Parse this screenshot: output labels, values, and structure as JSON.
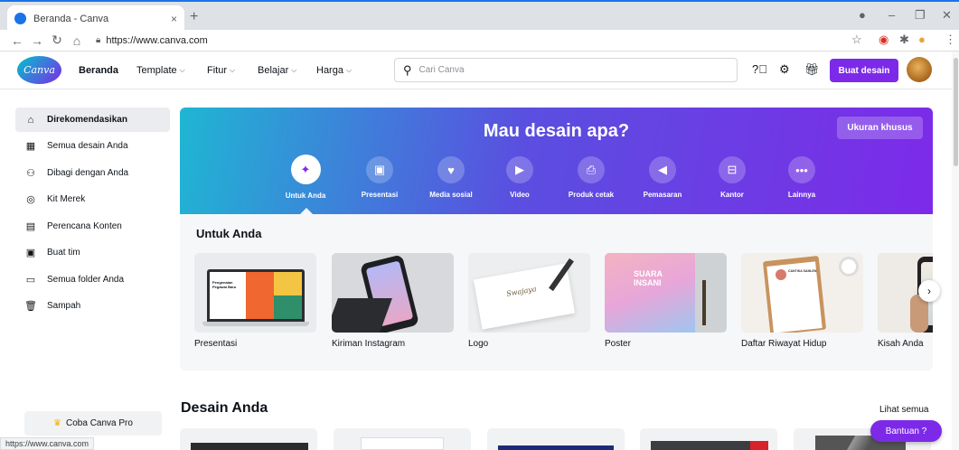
{
  "browser": {
    "tab_title": "Beranda - Canva",
    "tab_close": "×",
    "new_tab": "+",
    "url": "https://www.canva.com",
    "status_url": "https://www.canva.com"
  },
  "header": {
    "logo_text": "Canva",
    "nav": [
      {
        "label": "Beranda",
        "dropdown": false
      },
      {
        "label": "Template",
        "dropdown": true
      },
      {
        "label": "Fitur",
        "dropdown": true
      },
      {
        "label": "Belajar",
        "dropdown": true
      },
      {
        "label": "Harga",
        "dropdown": true
      }
    ],
    "search_placeholder": "Cari Canva",
    "create_button": "Buat desain"
  },
  "sidebar": {
    "items": [
      {
        "label": "Direkomendasikan",
        "icon": "home-icon",
        "active": true
      },
      {
        "label": "Semua desain Anda",
        "icon": "grid-icon",
        "active": false
      },
      {
        "label": "Dibagi dengan Anda",
        "icon": "shared-icon",
        "active": false
      },
      {
        "label": "Kit Merek",
        "icon": "brand-kit-icon",
        "active": false
      },
      {
        "label": "Perencana Konten",
        "icon": "calendar-icon",
        "active": false
      },
      {
        "label": "Buat tim",
        "icon": "team-icon",
        "active": false
      },
      {
        "label": "Semua folder Anda",
        "icon": "folder-icon",
        "active": false
      },
      {
        "label": "Sampah",
        "icon": "trash-icon",
        "active": false
      }
    ],
    "pro_button": "Coba Canva Pro"
  },
  "hero": {
    "title": "Mau desain apa?",
    "custom_size_button": "Ukuran khusus",
    "categories": [
      {
        "label": "Untuk Anda",
        "icon": "sparkle-icon",
        "active": true
      },
      {
        "label": "Presentasi",
        "icon": "presentation-icon",
        "active": false
      },
      {
        "label": "Media sosial",
        "icon": "social-media-icon",
        "active": false
      },
      {
        "label": "Video",
        "icon": "video-icon",
        "active": false
      },
      {
        "label": "Produk cetak",
        "icon": "print-icon",
        "active": false
      },
      {
        "label": "Pemasaran",
        "icon": "megaphone-icon",
        "active": false
      },
      {
        "label": "Kantor",
        "icon": "briefcase-icon",
        "active": false
      },
      {
        "label": "Lainnya",
        "icon": "more-icon",
        "active": false
      }
    ]
  },
  "for_you": {
    "title": "Untuk Anda",
    "cards": [
      {
        "label": "Presentasi",
        "thumb_text": "Pengenalan Pegawai Baru"
      },
      {
        "label": "Kiriman Instagram",
        "thumb_text": ""
      },
      {
        "label": "Logo",
        "thumb_text": "Swajaya"
      },
      {
        "label": "Poster",
        "thumb_text": "SUARA INSANI"
      },
      {
        "label": "Daftar Riwayat Hidup",
        "thumb_text": "CANTIKA SAMLEN"
      },
      {
        "label": "Kisah Anda",
        "thumb_text": ""
      }
    ]
  },
  "designs": {
    "title": "Desain Anda",
    "see_all": "Lihat semua"
  },
  "help_button": "Bantuan ?",
  "colors": {
    "primary": "#7d2ae8",
    "teal": "#00c4cc",
    "chrome": "#dee1e6"
  }
}
